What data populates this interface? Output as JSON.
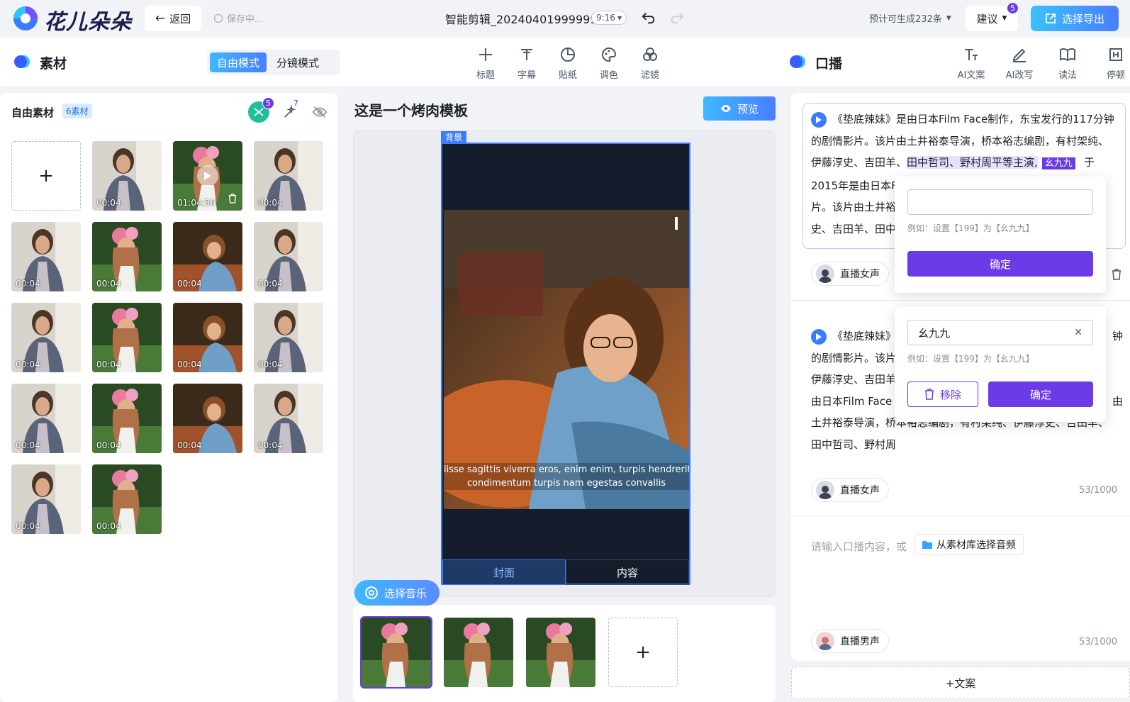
{
  "app": {
    "name": "花儿朵朵"
  },
  "topbar": {
    "back_label": "返回",
    "save_status": "保存中...",
    "project_title": "智能剪辑_20240401999999",
    "ratio": "9:16",
    "estimate": "预计可生成232条",
    "suggest_label": "建议",
    "suggest_badge": "5",
    "export_label": "选择导出"
  },
  "material": {
    "title": "素材",
    "modes": [
      "自由模式",
      "分镜模式"
    ],
    "active_mode": "自由模式",
    "tools": [
      {
        "label": "标题",
        "icon": "plus-icon"
      },
      {
        "label": "字幕",
        "icon": "subtitle-icon"
      },
      {
        "label": "贴纸",
        "icon": "sticker-icon"
      },
      {
        "label": "调色",
        "icon": "palette-icon"
      },
      {
        "label": "滤镜",
        "icon": "filter-icon"
      }
    ],
    "panel_title": "自由素材",
    "count_badge": "6素材",
    "icon_badge_1": "5",
    "icon_badge_2": "7",
    "add_symbol": "+",
    "items": [
      {
        "duration": "00:04",
        "kind": "jacket"
      },
      {
        "duration": "01:04:56",
        "kind": "flowers",
        "video": true
      },
      {
        "duration": "00:04",
        "kind": "jacket"
      },
      {
        "duration": "00:04",
        "kind": "jacket"
      },
      {
        "duration": "00:04",
        "kind": "flowers"
      },
      {
        "duration": "00:04",
        "kind": "desk"
      },
      {
        "duration": "00:04",
        "kind": "jacket"
      },
      {
        "duration": "00:04",
        "kind": "jacket"
      },
      {
        "duration": "00:04",
        "kind": "flowers"
      },
      {
        "duration": "00:04",
        "kind": "desk"
      },
      {
        "duration": "00:04",
        "kind": "jacket"
      },
      {
        "duration": "00:04",
        "kind": "jacket"
      },
      {
        "duration": "00:04",
        "kind": "flowers"
      },
      {
        "duration": "00:04",
        "kind": "desk"
      },
      {
        "duration": "00:04",
        "kind": "jacket"
      },
      {
        "duration": "00:04",
        "kind": "jacket"
      },
      {
        "duration": "00:04",
        "kind": "flowers"
      }
    ]
  },
  "center": {
    "template_title": "这是一个烤肉模板",
    "preview_label": "预览",
    "bg_tag": "背景",
    "subtitle_line1": "lisse sagittis viverra eros, enim enim, turpis hendrerit nec o",
    "subtitle_line2": "condimentum turpis nam egestas convallis",
    "tab_cover": "封面",
    "tab_content": "内容",
    "music_label": "选择音乐",
    "filmstrip_add": "+"
  },
  "broadcast": {
    "title": "口播",
    "tools": [
      {
        "label": "AI文案",
        "icon": "ai-text-icon"
      },
      {
        "label": "AI改写",
        "icon": "ai-rewrite-icon"
      },
      {
        "label": "读法",
        "icon": "book-icon"
      },
      {
        "label": "停顿",
        "icon": "pause-icon"
      }
    ],
    "block1": {
      "line1": "《垫底辣妹》是由日本Film Face制作，东宝发行的117分钟",
      "line2": "的剧情影片。该片由土井裕泰导演，桥本裕志编剧，有村架纯、",
      "line3_a": "伊藤淳史、吉田羊、",
      "line3_hl": "田中哲司、野村周平等主演,",
      "line3_tag": "幺九九",
      "line3_b": "于",
      "line4": "2015年是由日本F",
      "line5": "片。该片由土井裕",
      "line6": "史、吉田羊、田中",
      "voice": "直播女声"
    },
    "block2": {
      "line1_a": "《垫底辣妹》",
      "line1_b": "钟",
      "line2": "的剧情影片。该片",
      "line3": "伊藤淳史、吉田羊",
      "line4_a": "由日本Film Face",
      "line4_b": "由",
      "line5": "土井裕泰导演，桥本裕志编剧，有村架纯、伊藤淳史、吉田羊、",
      "line6": "田中哲司、野村周",
      "voice": "直播女声",
      "counter": "53/1000"
    },
    "input_placeholder": "请输入口播内容，或",
    "from_library": "从素材库选择音频",
    "block3": {
      "voice": "直播男声",
      "counter": "53/1000"
    },
    "add_copy": "+文案",
    "popover1": {
      "value": "",
      "hint": "例如：设置【199】为【幺九九】",
      "confirm": "确定"
    },
    "popover2": {
      "value": "幺九九",
      "hint": "例如：设置【199】为【幺九九】",
      "remove": "移除",
      "confirm": "确定"
    }
  },
  "colors": {
    "accent_purple": "#6b3be8",
    "accent_blue": "#3a7bff",
    "gradient_start": "#3fb8ff"
  }
}
